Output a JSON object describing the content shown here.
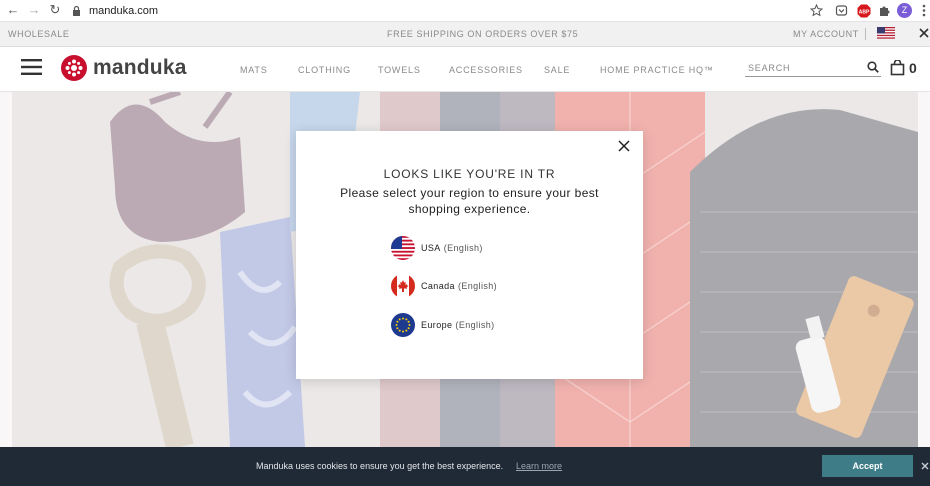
{
  "browser": {
    "url": "manduka.com",
    "profile_initial": "Z"
  },
  "utility_bar": {
    "wholesale": "WHOLESALE",
    "shipping": "FREE SHIPPING ON ORDERS OVER $75",
    "my_account": "MY ACCOUNT"
  },
  "header": {
    "brand": "manduka",
    "nav": [
      "MATS",
      "CLOTHING",
      "TOWELS",
      "ACCESSORIES",
      "SALE",
      "HOME PRACTICE HQ™"
    ],
    "search_placeholder": "SEARCH",
    "cart_count": "0"
  },
  "modal": {
    "title": "LOOKS LIKE YOU'RE IN TR",
    "message": "Please select your region to ensure your best shopping experience.",
    "regions": [
      {
        "name": "USA",
        "lang": "(English)",
        "icon": "us-flag-icon"
      },
      {
        "name": "Canada",
        "lang": "(English)",
        "icon": "canada-flag-icon"
      },
      {
        "name": "Europe",
        "lang": "(English)",
        "icon": "eu-flag-icon"
      }
    ]
  },
  "cookie_bar": {
    "message": "Manduka uses cookies to ensure you get the best experience.",
    "learn_more": "Learn more",
    "accept": "Accept"
  },
  "colors": {
    "brand_red": "#c8102e",
    "cookie_bg": "#1f2a36",
    "accept_button": "#3e7d87"
  }
}
